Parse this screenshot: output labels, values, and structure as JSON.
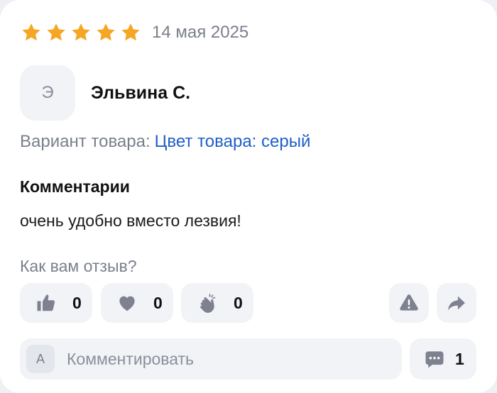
{
  "review": {
    "rating": 5,
    "rating_max": 5,
    "star_color": "#f5a623",
    "date": "14 мая 2025",
    "author": {
      "initial": "Э",
      "name": "Эльвина С."
    },
    "variant": {
      "label": "Вариант товара:",
      "value": "Цвет товара: серый"
    },
    "comment_title": "Комментарии",
    "comment_text": "очень удобно вместо лезвия!",
    "feedback_prompt": "Как вам отзыв?",
    "reactions": [
      {
        "icon": "thumbs-up-icon",
        "count": "0"
      },
      {
        "icon": "heart-icon",
        "count": "0"
      },
      {
        "icon": "clapping-hands-icon",
        "count": "0"
      }
    ],
    "actions": {
      "report_icon": "warning-icon",
      "share_icon": "share-arrow-icon"
    },
    "comment_input": {
      "avatar_initial": "А",
      "placeholder": "Комментировать"
    },
    "comments_count": "1"
  },
  "colors": {
    "link": "#1e5fc8",
    "muted_text": "#7a7f8c",
    "chip_background": "#f2f3f6",
    "icon": "#7d8190"
  }
}
